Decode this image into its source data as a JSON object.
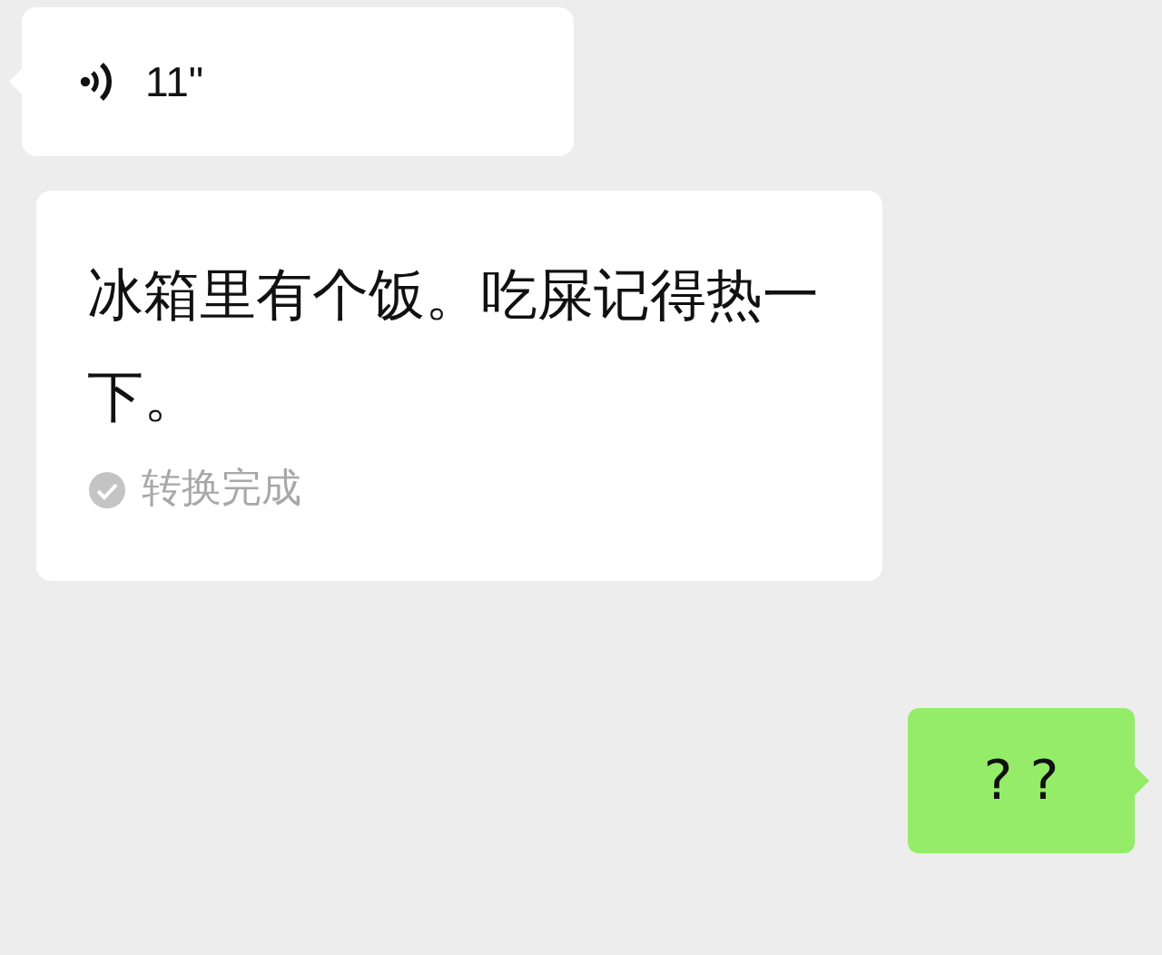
{
  "messages": [
    {
      "kind": "voice",
      "duration": "11\""
    },
    {
      "kind": "transcript",
      "text": "冰箱里有个饭。吃屎记得热一下。",
      "status": "转换完成"
    },
    {
      "kind": "sent",
      "text": "? ?"
    }
  ]
}
